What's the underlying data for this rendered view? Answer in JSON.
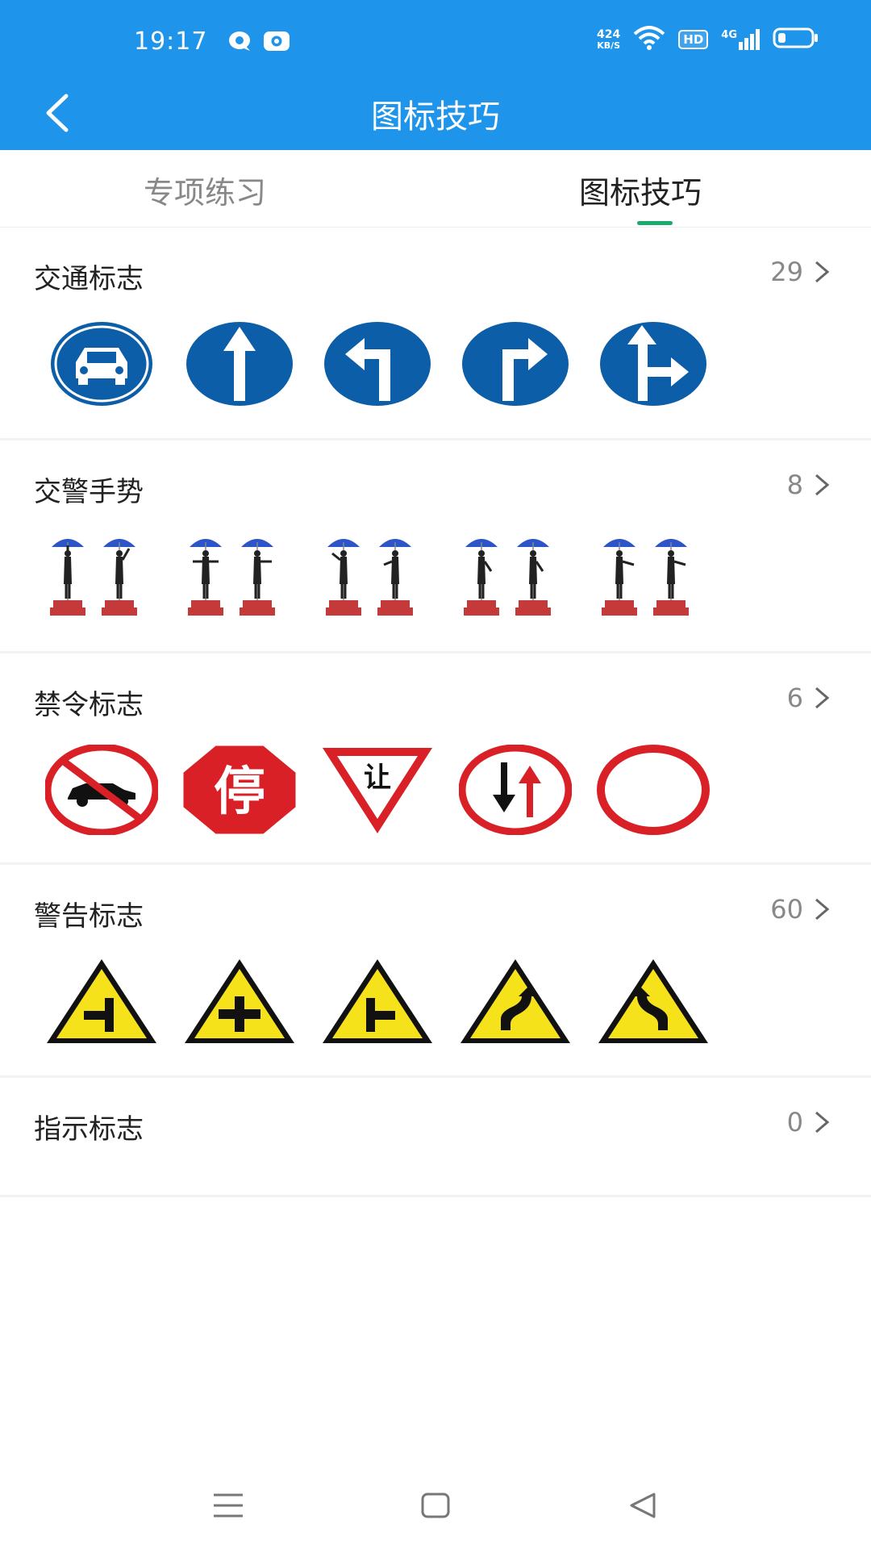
{
  "status_bar": {
    "time": "19:17",
    "net_speed_value": "424",
    "net_speed_unit": "KB/S",
    "hd_label": "HD",
    "signal_label": "4G",
    "icons": [
      "message-bubble-icon",
      "camera-circle-icon",
      "wifi-icon",
      "signal-bars-icon",
      "battery-icon"
    ]
  },
  "header": {
    "title": "图标技巧",
    "back_icon": "chevron-left-icon"
  },
  "tabs": [
    {
      "label": "专项练习",
      "active": false
    },
    {
      "label": "图标技巧",
      "active": true
    }
  ],
  "sections": [
    {
      "title": "交通标志",
      "count": "29",
      "icons": [
        "car-sign-icon",
        "straight-arrow-sign-icon",
        "left-turn-sign-icon",
        "right-turn-sign-icon",
        "straight-or-right-sign-icon"
      ]
    },
    {
      "title": "交警手势",
      "count": "8",
      "icons": [
        "police-gesture-stop-icon",
        "police-gesture-straight-icon",
        "police-gesture-left-turn-icon",
        "police-gesture-right-turn-icon",
        "police-gesture-slow-down-icon"
      ]
    },
    {
      "title": "禁令标志",
      "count": "6",
      "icons": [
        "no-cars-sign-icon",
        "stop-sign-icon",
        "yield-sign-icon",
        "oncoming-priority-sign-icon",
        "no-vehicles-sign-icon"
      ]
    },
    {
      "title": "警告标志",
      "count": "60",
      "icons": [
        "t-junction-left-sign-icon",
        "crossroad-sign-icon",
        "t-junction-right-sign-icon",
        "winding-road-right-sign-icon",
        "winding-road-left-sign-icon"
      ]
    },
    {
      "title": "指示标志",
      "count": "0",
      "icons": []
    }
  ],
  "stop_sign_text": "停",
  "yield_sign_text": "让",
  "colors": {
    "header_blue": "#1e95ea",
    "sign_blue": "#0b5ea7",
    "sign_red": "#d92027",
    "warning_yellow": "#f6e21a",
    "tab_indicator_green": "#1aaa6e"
  },
  "system_nav": [
    "menu-icon",
    "home-icon",
    "back-triangle-icon"
  ]
}
